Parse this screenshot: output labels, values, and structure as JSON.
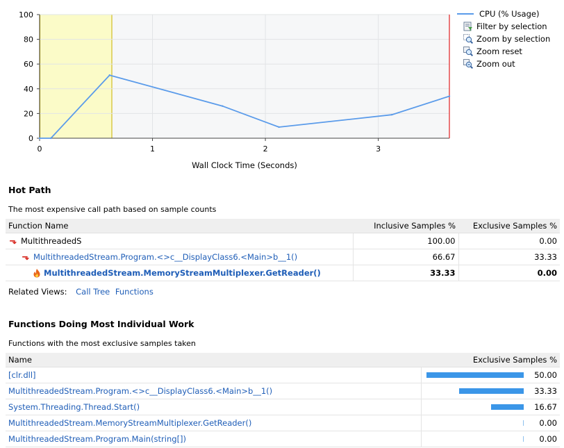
{
  "chart_data": {
    "type": "line",
    "title": "",
    "xlabel": "Wall Clock Time (Seconds)",
    "ylabel": "",
    "xlim": [
      0,
      3.63
    ],
    "ylim": [
      0,
      100
    ],
    "x_ticks": [
      "0",
      "1",
      "2",
      "3"
    ],
    "y_ticks": [
      "0",
      "20",
      "40",
      "60",
      "80",
      "100"
    ],
    "grid": true,
    "selection_range": [
      0,
      0.64
    ],
    "series": [
      {
        "name": "CPU (% Usage)",
        "color": "#5a9bea",
        "x": [
          0,
          0.1,
          0.62,
          1.62,
          2.12,
          3.12,
          3.63
        ],
        "y": [
          0,
          0,
          51,
          26,
          9,
          19,
          34
        ]
      }
    ]
  },
  "legend": {
    "series_label": "CPU (% Usage)",
    "actions": [
      {
        "label": "Filter by selection",
        "icon": "filter-icon"
      },
      {
        "label": "Zoom by selection",
        "icon": "zoom-selection-icon"
      },
      {
        "label": "Zoom reset",
        "icon": "zoom-reset-icon"
      },
      {
        "label": "Zoom out",
        "icon": "zoom-out-icon"
      }
    ]
  },
  "hot_path": {
    "title": "Hot Path",
    "description": "The most expensive call path based on sample counts",
    "columns": [
      "Function Name",
      "Inclusive Samples %",
      "Exclusive Samples %"
    ],
    "rows": [
      {
        "name": "MultithreadedS",
        "inclusive": "100.00",
        "exclusive": "0.00"
      },
      {
        "name": "MultithreadedStream.Program.<>c__DisplayClass6.<Main>b__1()",
        "inclusive": "66.67",
        "exclusive": "33.33"
      },
      {
        "name": "MultithreadedStream.MemoryStreamMultiplexer.GetReader()",
        "inclusive": "33.33",
        "exclusive": "0.00"
      }
    ]
  },
  "related_views": {
    "label": "Related Views:",
    "links": [
      "Call Tree",
      "Functions"
    ]
  },
  "most_work": {
    "title": "Functions Doing Most Individual Work",
    "description": "Functions with the most exclusive samples taken",
    "columns": [
      "Name",
      "Exclusive Samples %"
    ],
    "rows": [
      {
        "name": "[clr.dll]",
        "value": "50.00",
        "pct": 0.5
      },
      {
        "name": "MultithreadedStream.Program.<>c__DisplayClass6.<Main>b__1()",
        "value": "33.33",
        "pct": 0.3333
      },
      {
        "name": "System.Threading.Thread.Start()",
        "value": "16.67",
        "pct": 0.1667
      },
      {
        "name": "MultithreadedStream.MemoryStreamMultiplexer.GetReader()",
        "value": "0.00",
        "pct": 0
      },
      {
        "name": "MultithreadedStream.Program.Main(string[])",
        "value": "0.00",
        "pct": 0
      }
    ]
  },
  "colors": {
    "line": "#5a9bea",
    "selection": "#fbfbc8",
    "selection_edge": "#c9b000",
    "end_marker": "#e02020",
    "link": "#1e5db7",
    "bar": "#3b96e8",
    "hot_arrow": "#d7261e"
  }
}
